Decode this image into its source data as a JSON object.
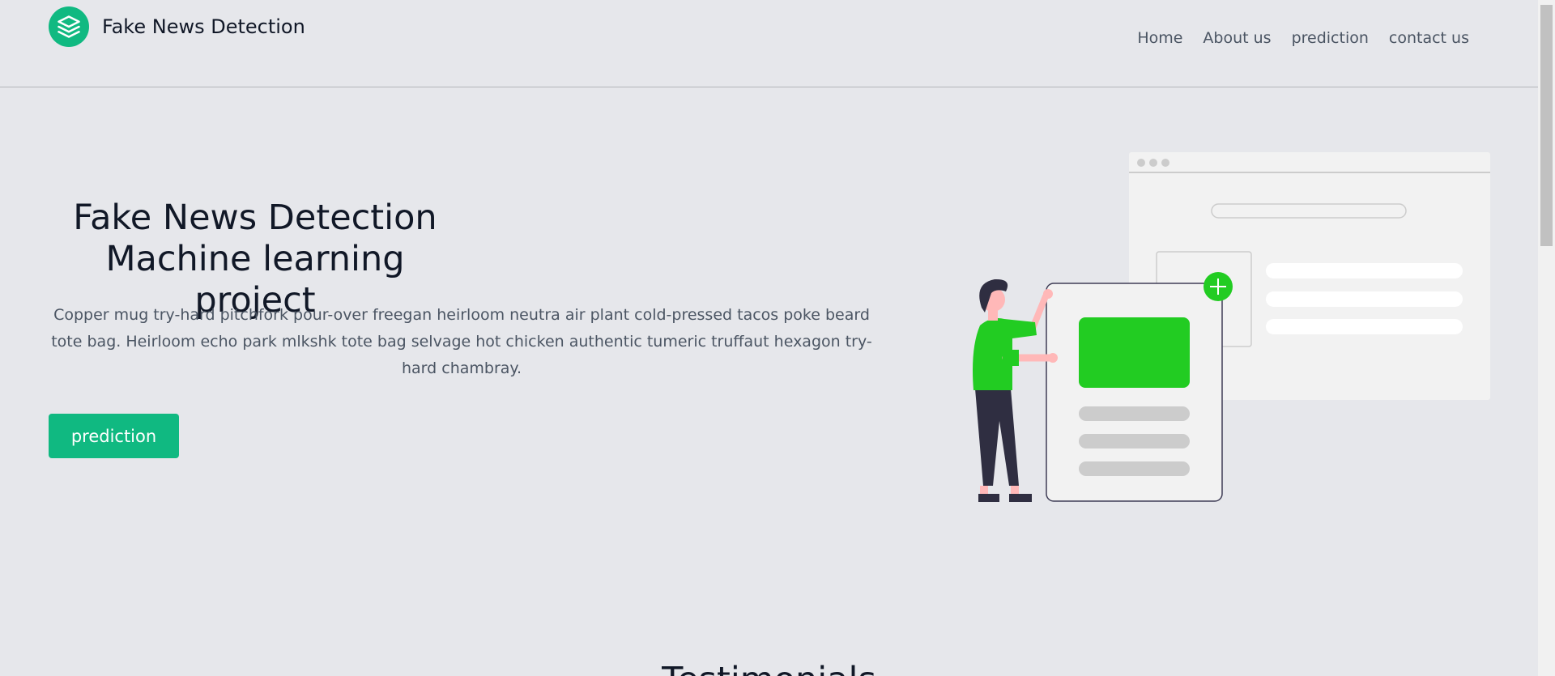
{
  "header": {
    "brand_title": "Fake News Detection",
    "brand_icon": "layers-icon",
    "nav": [
      {
        "label": "Home"
      },
      {
        "label": "About us"
      },
      {
        "label": "prediction"
      },
      {
        "label": "contact us"
      }
    ]
  },
  "hero": {
    "title_line1": "Fake News Detection",
    "title_line2": "Machine learning project",
    "description": "Copper mug try-hard pitchfork pour-over freegan heirloom neutra air plant cold-pressed tacos poke beard tote bag. Heirloom echo park mlkshk tote bag selvage hot chicken authentic tumeric truffaut hexagon try-hard chambray.",
    "button_label": "prediction"
  },
  "next_section": {
    "heading": "Testimonials"
  },
  "colors": {
    "accent": "#10b981",
    "illustration_green": "#22cc22",
    "background": "#e6e7eb"
  }
}
